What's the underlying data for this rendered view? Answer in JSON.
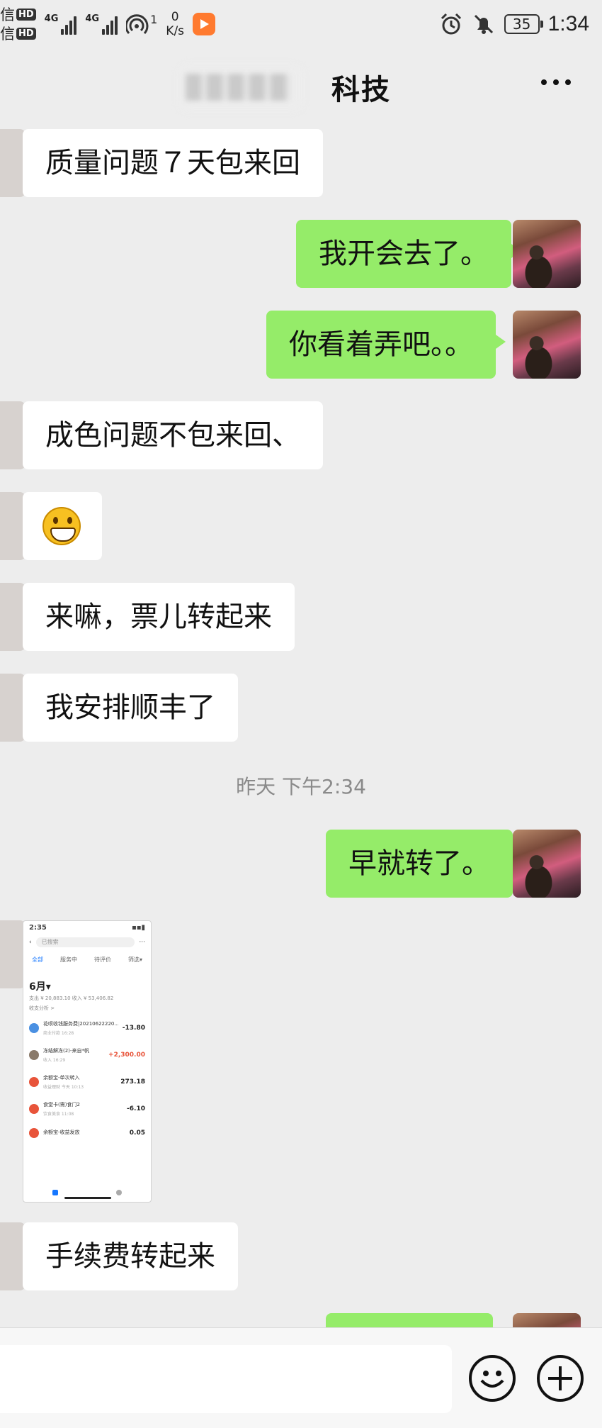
{
  "status_bar": {
    "sim1_label": "信",
    "sim2_label": "信",
    "hd_label": "HD",
    "network_label": "4G",
    "speed_value": "0",
    "speed_unit": "K/s",
    "hotspot_count": "1",
    "battery": "35",
    "time": "1:34",
    "icons": [
      "signal-icon",
      "wifi-hotspot-icon",
      "video-app-icon",
      "alarm-icon",
      "bell-muted-icon",
      "battery-icon"
    ]
  },
  "header": {
    "title": "科技",
    "more_icon": "more-icon"
  },
  "messages": [
    {
      "side": "in",
      "text": "质量问题７天包来回"
    },
    {
      "side": "out",
      "text": "我开会去了。"
    },
    {
      "side": "out",
      "text": "你看着弄吧。。"
    },
    {
      "side": "in",
      "text": "成色问题不包来回、"
    },
    {
      "side": "in",
      "type": "emoji",
      "emoji": "grinning-face-emoji"
    },
    {
      "side": "in",
      "text": "来嘛，票儿转起来"
    },
    {
      "side": "in",
      "text": "我安排顺丰了"
    },
    {
      "side": "out",
      "text": "早就转了。"
    },
    {
      "side": "in",
      "type": "image"
    },
    {
      "side": "in",
      "text": "手续费转起来"
    }
  ],
  "timestamp": "昨天 下午2:34",
  "screenshot_thumb": {
    "time": "2:35",
    "search_placeholder": "已搜索",
    "tabs": [
      "全部",
      "服务中",
      "待评价",
      "筛选▾"
    ],
    "month": "6月▾",
    "summary": "支出 ¥ 20,883.10  收入 ¥ 53,406.82",
    "sub": "收支分析 >",
    "rows": [
      {
        "title": "花呗收钱服务费|20210622220...",
        "sub": "商业付款  16:28",
        "amount": "-13.80",
        "color": "#4a90e2",
        "red": false
      },
      {
        "title": "冻结解冻(2)-来自*帆",
        "sub": "收入  16:29",
        "amount": "+2,300.00",
        "color": "#8a7a6a",
        "red": true
      },
      {
        "title": "余额宝-单次转入",
        "sub": "收益理财  今天 10:13",
        "amount": "273.18",
        "color": "#e8543a",
        "red": false
      },
      {
        "title": "食堂卡(需)食门2",
        "sub": "饮食美食  11:08",
        "amount": "-6.10",
        "color": "#e8543a",
        "red": false
      },
      {
        "title": "余额宝-收益发放",
        "sub": "",
        "amount": "0.05",
        "color": "#e8543a",
        "red": false
      }
    ]
  },
  "input_bar": {
    "emoji_icon": "emoji-icon",
    "plus_icon": "plus-icon"
  }
}
